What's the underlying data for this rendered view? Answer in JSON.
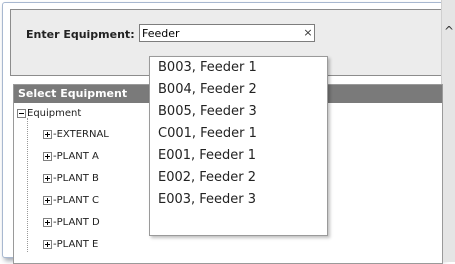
{
  "form": {
    "equipment_label": "Enter Equipment:",
    "search_value": "Feeder",
    "clear_glyph": "×"
  },
  "scrollbar": {
    "up_arrow_glyph": "^"
  },
  "select_panel": {
    "header": "Select Equipment",
    "root": "Equipment",
    "children": [
      "EXTERNAL",
      "PLANT A",
      "PLANT B",
      "PLANT C",
      "PLANT D",
      "PLANT E"
    ]
  },
  "dropdown": {
    "items": [
      "B003, Feeder 1",
      "B004, Feeder 2",
      "B005, Feeder 3",
      "C001, Feeder 1",
      "E001, Feeder 1",
      "E002, Feeder 2",
      "E003, Feeder 3"
    ]
  },
  "icons": {
    "expand": "plus-box-icon",
    "collapse": "minus-box-icon",
    "clear": "close-icon",
    "scroll_up": "chevron-up-icon"
  }
}
